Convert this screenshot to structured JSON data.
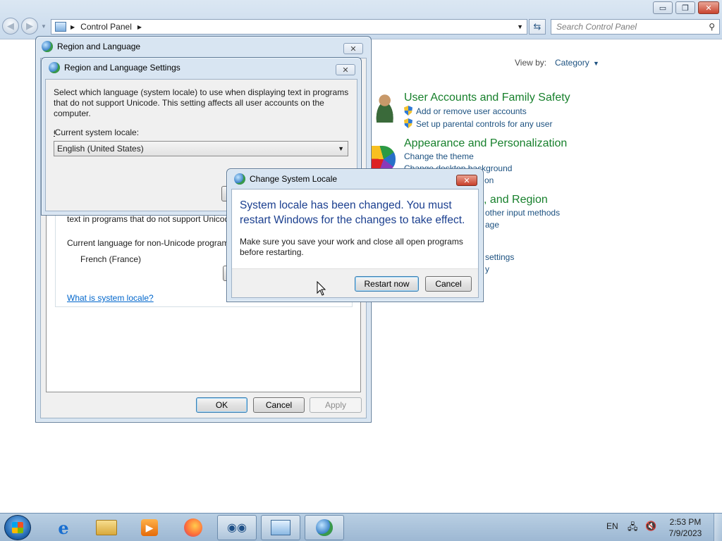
{
  "control_panel": {
    "address_root": "Control Panel",
    "search_placeholder": "Search Control Panel",
    "view_by_label": "View by:",
    "view_by_value": "Category",
    "categories": [
      {
        "heading": "User Accounts and Family Safety",
        "links": [
          "Add or remove user accounts",
          "Set up parental controls for any user"
        ]
      },
      {
        "heading": "Appearance and Personalization",
        "links": [
          "Change the theme",
          "Change desktop background",
          "on"
        ]
      },
      {
        "heading": ", and Region",
        "links": [
          "other input methods",
          "age"
        ]
      },
      {
        "heading": "",
        "links": [
          "settings",
          "y"
        ]
      }
    ]
  },
  "region_language": {
    "title": "Region and Language",
    "partial_text": "text in programs that do not support Unicod",
    "current_lang_label": "Current language for non-Unicode program",
    "current_lang_value": "French (France)",
    "what_is_link": "What is system locale?",
    "ok": "OK",
    "cancel": "Cancel",
    "apply": "Apply"
  },
  "settings_dialog": {
    "title": "Region and Language Settings",
    "description": "Select which language (system locale) to use when displaying text in programs that do not support Unicode. This setting affects all user accounts on the computer.",
    "locale_label": "Current system locale:",
    "locale_value": "English (United States)"
  },
  "locale_dialog": {
    "title": "Change System Locale",
    "message": "System locale has been changed. You must restart Windows for the changes to take effect.",
    "detail": "Make sure you save your work and close all open programs before restarting.",
    "restart_now": "Restart now",
    "cancel": "Cancel"
  },
  "taskbar": {
    "language": "EN",
    "time": "2:53 PM",
    "date": "7/9/2023"
  }
}
